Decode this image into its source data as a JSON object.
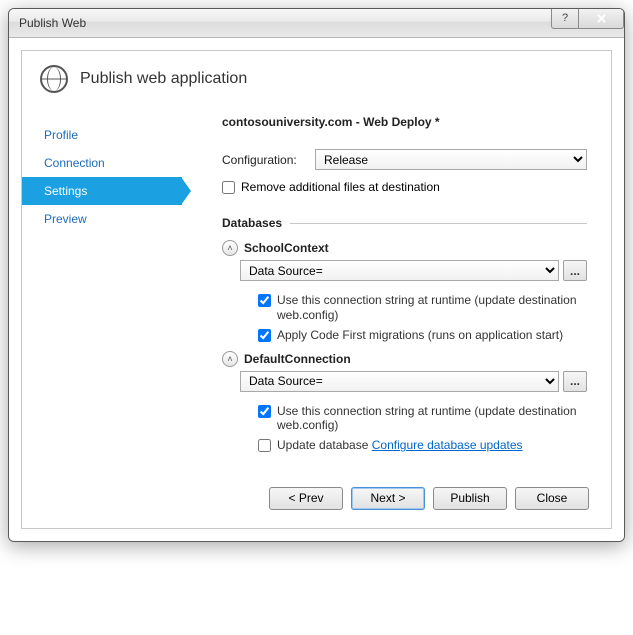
{
  "window": {
    "title": "Publish Web"
  },
  "header": {
    "heading": "Publish web application"
  },
  "sidebar": {
    "items": [
      {
        "label": "Profile"
      },
      {
        "label": "Connection"
      },
      {
        "label": "Settings",
        "active": true
      },
      {
        "label": "Preview"
      }
    ]
  },
  "content": {
    "profile_title": "contosouniversity.com - Web Deploy *",
    "config_label": "Configuration:",
    "config_value": "Release",
    "remove_files_label": "Remove additional files at destination",
    "remove_files_checked": false,
    "databases_heading": "Databases",
    "dbs": [
      {
        "name": "SchoolContext",
        "conn": "Data Source=",
        "use_runtime_label": "Use this connection string at runtime (update destination web.config)",
        "use_runtime_checked": true,
        "second_label": "Apply Code First migrations (runs on application start)",
        "second_checked": true,
        "second_link": ""
      },
      {
        "name": "DefaultConnection",
        "conn": "Data Source=",
        "use_runtime_label": "Use this connection string at runtime (update destination web.config)",
        "use_runtime_checked": true,
        "second_label": "Update database",
        "second_checked": false,
        "second_link": "Configure database updates"
      }
    ]
  },
  "footer": {
    "prev": "< Prev",
    "next": "Next >",
    "publish": "Publish",
    "close": "Close"
  },
  "glyphs": {
    "help": "?",
    "chevron_up": "˄",
    "ellipsis": "..."
  }
}
